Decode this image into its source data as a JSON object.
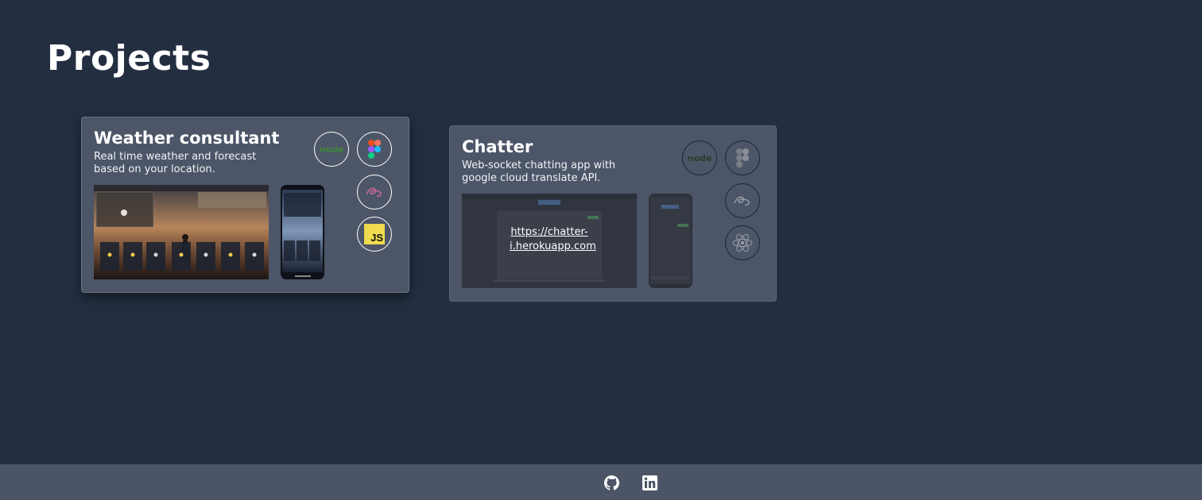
{
  "page": {
    "title": "Projects"
  },
  "projects": [
    {
      "title": "Weather consultant",
      "description": "Real time weather and forecast based on your location.",
      "tech": [
        "node-icon",
        "figma-icon",
        "sass-icon",
        "javascript-icon"
      ],
      "js_label": "JS",
      "node_label": "node"
    },
    {
      "title": "Chatter",
      "description": "Web-socket chatting app with google cloud translate API.",
      "link": "https://chatter-i.herokuapp.com",
      "tech": [
        "node-icon",
        "figma-icon",
        "sass-icon",
        "react-icon"
      ],
      "node_label": "node"
    }
  ],
  "footer": {
    "icons": [
      "github-icon",
      "linkedin-icon"
    ]
  },
  "colors": {
    "background": "#232e41",
    "card": "#4c5668",
    "footer": "#4b5567",
    "js": "#f0db4f"
  }
}
